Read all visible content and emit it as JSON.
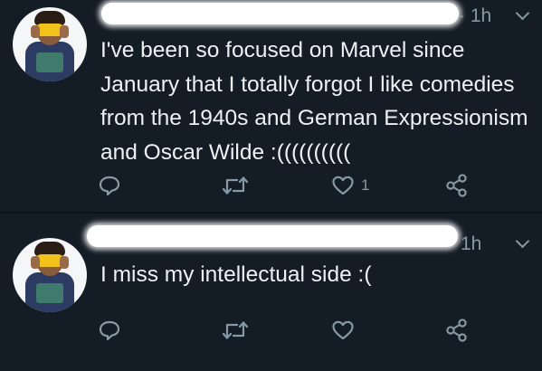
{
  "tweets": [
    {
      "time": "· 1h",
      "text": "I've been so focused on Marvel since January that I totally forgot I like comedies from the 1940s and German Expressionism and Oscar Wilde :((((((((((",
      "like_count": "1"
    },
    {
      "time": "1h",
      "text": "I miss my intellectual side :(",
      "like_count": ""
    }
  ],
  "icons": {
    "reply": "reply-bubble-icon",
    "retweet": "retweet-icon",
    "like": "heart-icon",
    "share": "share-icon",
    "menu": "chevron-down-icon"
  },
  "colors": {
    "background": "#141d26",
    "text": "#eef1f3",
    "secondary": "#8899a6"
  }
}
